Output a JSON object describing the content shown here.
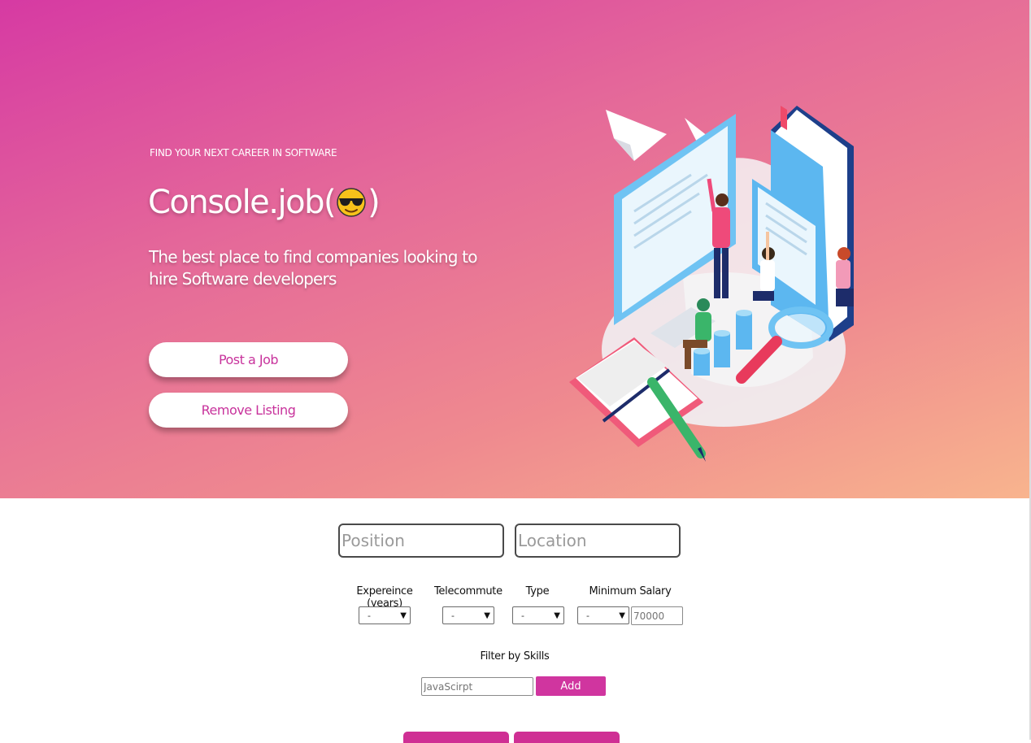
{
  "hero": {
    "eyebrow": "FIND YOUR NEXT CAREER IN SOFTWARE",
    "brand_prefix": "Console.job(",
    "brand_suffix": ")",
    "brand_emoji": "sunglasses-emoji",
    "tagline": "The best place to find companies looking to hire Software developers",
    "post_job_label": "Post a Job",
    "remove_listing_label": "Remove Listing",
    "illustration": "people-working-with-screens-illustration"
  },
  "search": {
    "position_placeholder": "Position",
    "location_placeholder": "Location"
  },
  "filters": {
    "experience_label": "Expereince (years)",
    "experience_value": "-",
    "telecommute_label": "Telecommute",
    "telecommute_value": "-",
    "type_label": "Type",
    "type_value": "-",
    "salary_label": "Minimum Salary",
    "salary_value": "-",
    "salary_placeholder": "70000"
  },
  "skills": {
    "label": "Filter by Skills",
    "placeholder": "JavaScirpt",
    "add_label": "Add"
  },
  "colors": {
    "gradient_start": "#d63aa3",
    "gradient_end": "#f8b48e",
    "accent": "#d0359f"
  }
}
